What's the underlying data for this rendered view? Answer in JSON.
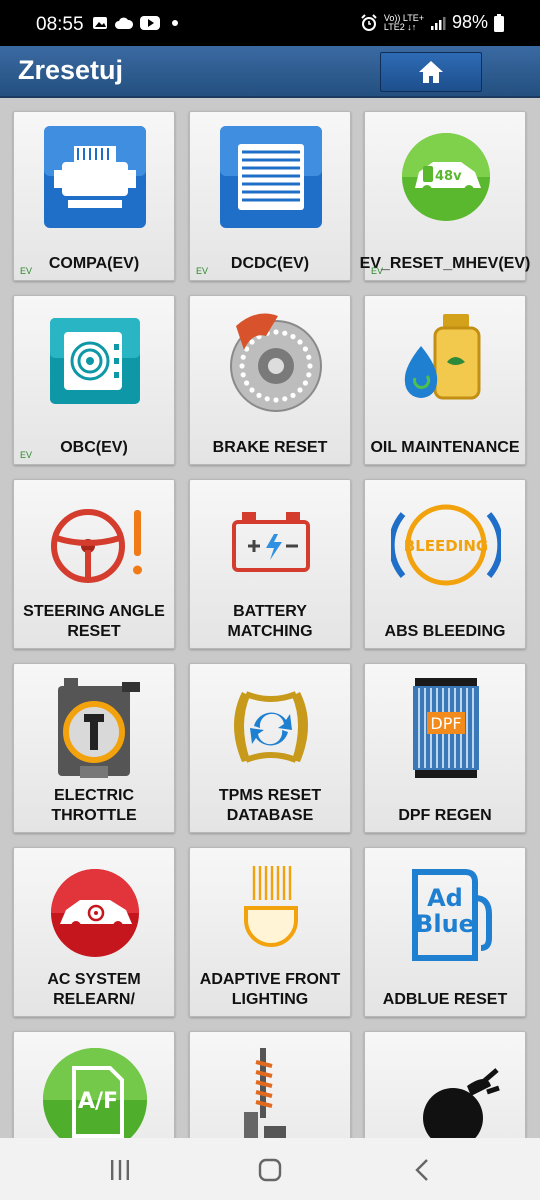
{
  "status_bar": {
    "time": "08:55",
    "left_icons": [
      "image-icon",
      "cloud-icon",
      "youtube-icon"
    ],
    "network_top": "Vo)) LTE+",
    "network_bottom": "LTE2 ↓↑",
    "battery": "98%"
  },
  "header": {
    "title": "Zresetuj",
    "home_icon": "home-icon"
  },
  "tiles": [
    {
      "label": "COMPA(EV)",
      "badge": "EV",
      "icon": "compressor-icon"
    },
    {
      "label": "DCDC(EV)",
      "badge": "EV",
      "icon": "dcdc-converter-icon"
    },
    {
      "label": "EV_RESET_MHEV(EV)",
      "badge": "EV",
      "icon": "mhev-car-icon",
      "icon_text": "48v"
    },
    {
      "label": "OBC(EV)",
      "badge": "EV",
      "icon": "onboard-charger-icon"
    },
    {
      "label": "BRAKE RESET",
      "badge": "",
      "icon": "brake-disc-icon"
    },
    {
      "label": "OIL MAINTENANCE",
      "badge": "",
      "icon": "oil-can-icon"
    },
    {
      "label": "STEERING ANGLE RESET",
      "badge": "",
      "icon": "steering-wheel-icon"
    },
    {
      "label": "BATTERY MATCHING",
      "badge": "",
      "icon": "battery-icon"
    },
    {
      "label": "ABS BLEEDING",
      "badge": "",
      "icon": "abs-bleeding-icon",
      "icon_text": "BLEEDING"
    },
    {
      "label": "ELECTRIC THROTTLE",
      "badge": "",
      "icon": "throttle-body-icon"
    },
    {
      "label": "TPMS RESET DATABASE",
      "badge": "",
      "icon": "tpms-icon"
    },
    {
      "label": "DPF REGEN",
      "badge": "",
      "icon": "dpf-filter-icon",
      "icon_text": "DPF"
    },
    {
      "label": "AC SYSTEM RELEARN/",
      "badge": "",
      "icon": "ac-car-icon"
    },
    {
      "label": "ADAPTIVE FRONT LIGHTING",
      "badge": "",
      "icon": "headlight-icon"
    },
    {
      "label": "ADBLUE RESET",
      "badge": "",
      "icon": "adblue-icon",
      "icon_text": "Ad Blue"
    },
    {
      "label": "",
      "badge": "",
      "icon": "air-fuel-icon",
      "icon_text": "A/F"
    },
    {
      "label": "",
      "badge": "",
      "icon": "suspension-icon"
    },
    {
      "label": "",
      "badge": "",
      "icon": "airbag-icon"
    }
  ],
  "nav_bar": {
    "recent_icon": "recent-apps-icon",
    "home_icon": "nav-home-icon",
    "back_icon": "back-icon"
  }
}
